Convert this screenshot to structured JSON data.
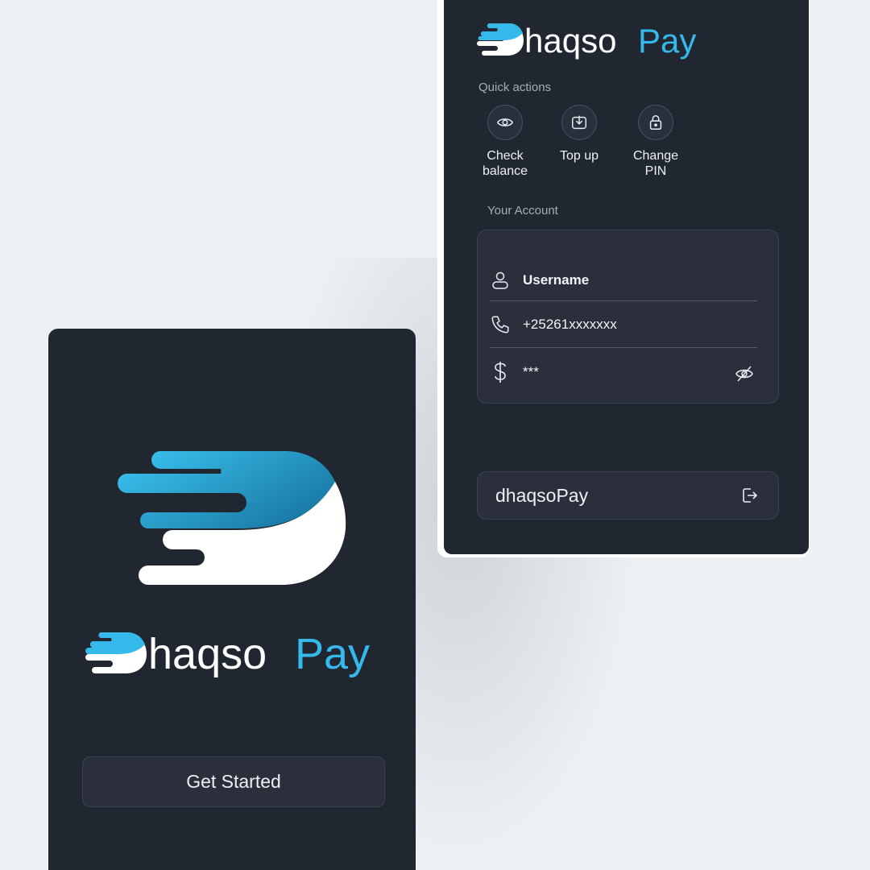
{
  "colors": {
    "background": "#edf1f4",
    "card": "#212731",
    "field": "#2a2f3b",
    "accent_blue": "#35b8ea",
    "white": "#ffffff"
  },
  "splash": {
    "logo_icon": "dhaqso-mark-icon",
    "wordmark_dark_part": "Dhaqso",
    "wordmark_accent_part": "Pay",
    "get_started_label": "Get Started"
  },
  "dashboard": {
    "wordmark_dark_part": "Dhaqso",
    "wordmark_accent_part": "Pay",
    "quick_actions_label": "Quick actions",
    "quick_actions": [
      {
        "icon": "eye-icon",
        "label": "Check\nbalance"
      },
      {
        "icon": "download-icon",
        "label": "Top up"
      },
      {
        "icon": "lock-icon",
        "label": "Change\nPIN"
      }
    ],
    "account_label": "Your Account",
    "account": {
      "username_icon": "user-icon",
      "username": "Username",
      "phone_icon": "phone-icon",
      "phone": "+25261xxxxxxx",
      "balance_icon": "dollar-icon",
      "balance": "***",
      "toggle_icon": "eye-off-icon"
    },
    "brand_name": "dhaqsoPay",
    "logout_icon": "logout-icon"
  }
}
